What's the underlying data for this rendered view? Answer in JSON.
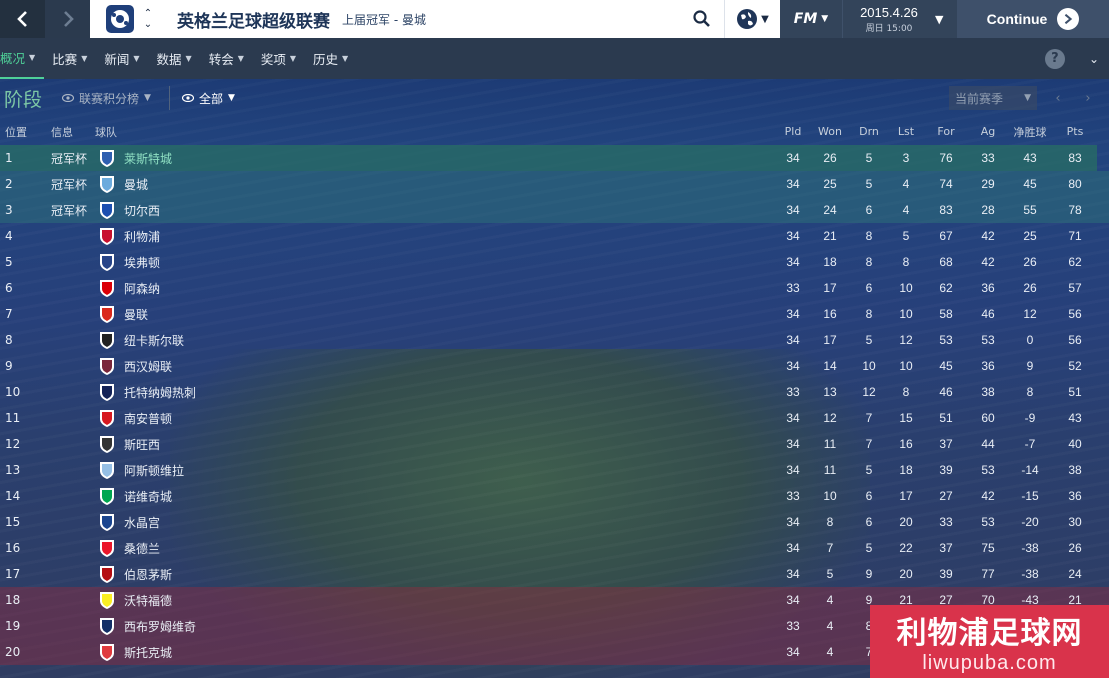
{
  "topbar": {
    "back_icon": "chevron-left-icon",
    "forward_icon": "chevron-right-icon",
    "league_title": "英格兰足球超级联赛",
    "league_subtitle": "上届冠军 - 曼城",
    "fm_label": "FM",
    "date": "2015.4.26",
    "date_sub": "周日 15:00",
    "continue_label": "Continue"
  },
  "menu": {
    "items": [
      {
        "label": "概况",
        "active": true
      },
      {
        "label": "比赛"
      },
      {
        "label": "新闻"
      },
      {
        "label": "数据"
      },
      {
        "label": "转会"
      },
      {
        "label": "奖项"
      },
      {
        "label": "历史"
      }
    ],
    "help_label": "?"
  },
  "filters": {
    "stage_label": "阶段",
    "table_select": "联赛积分榜",
    "view_select": "全部",
    "season_select": "当前赛季"
  },
  "table": {
    "headers": {
      "pos": "位置",
      "info": "信息",
      "team": "球队",
      "pld": "Pld",
      "won": "Won",
      "drn": "Drn",
      "lst": "Lst",
      "for": "For",
      "ag": "Ag",
      "gd": "净胜球",
      "pts": "Pts"
    },
    "rows": [
      {
        "pos": "1",
        "info": "冠军杯",
        "team": "莱斯特城",
        "pld": "34",
        "won": "26",
        "drn": "5",
        "lst": "3",
        "for": "76",
        "ag": "33",
        "gd": "43",
        "pts": "83",
        "badge_color": "#2f5fb0"
      },
      {
        "pos": "2",
        "info": "冠军杯",
        "team": "曼城",
        "pld": "34",
        "won": "25",
        "drn": "5",
        "lst": "4",
        "for": "74",
        "ag": "29",
        "gd": "45",
        "pts": "80",
        "badge_color": "#6cabdd"
      },
      {
        "pos": "3",
        "info": "冠军杯",
        "team": "切尔西",
        "pld": "34",
        "won": "24",
        "drn": "6",
        "lst": "4",
        "for": "83",
        "ag": "28",
        "gd": "55",
        "pts": "78",
        "badge_color": "#1d4fb0"
      },
      {
        "pos": "4",
        "info": "",
        "team": "利物浦",
        "pld": "34",
        "won": "21",
        "drn": "8",
        "lst": "5",
        "for": "67",
        "ag": "42",
        "gd": "25",
        "pts": "71",
        "badge_color": "#c8102e"
      },
      {
        "pos": "5",
        "info": "",
        "team": "埃弗顿",
        "pld": "34",
        "won": "18",
        "drn": "8",
        "lst": "8",
        "for": "68",
        "ag": "42",
        "gd": "26",
        "pts": "62",
        "badge_color": "#274488"
      },
      {
        "pos": "6",
        "info": "",
        "team": "阿森纳",
        "pld": "33",
        "won": "17",
        "drn": "6",
        "lst": "10",
        "for": "62",
        "ag": "36",
        "gd": "26",
        "pts": "57",
        "badge_color": "#db0007"
      },
      {
        "pos": "7",
        "info": "",
        "team": "曼联",
        "pld": "34",
        "won": "16",
        "drn": "8",
        "lst": "10",
        "for": "58",
        "ag": "46",
        "gd": "12",
        "pts": "56",
        "badge_color": "#da291c"
      },
      {
        "pos": "8",
        "info": "",
        "team": "纽卡斯尔联",
        "pld": "34",
        "won": "17",
        "drn": "5",
        "lst": "12",
        "for": "53",
        "ag": "53",
        "gd": "0",
        "pts": "56",
        "badge_color": "#222222"
      },
      {
        "pos": "9",
        "info": "",
        "team": "西汉姆联",
        "pld": "34",
        "won": "14",
        "drn": "10",
        "lst": "10",
        "for": "45",
        "ag": "36",
        "gd": "9",
        "pts": "52",
        "badge_color": "#7a263a"
      },
      {
        "pos": "10",
        "info": "",
        "team": "托特纳姆热刺",
        "pld": "33",
        "won": "13",
        "drn": "12",
        "lst": "8",
        "for": "46",
        "ag": "38",
        "gd": "8",
        "pts": "51",
        "badge_color": "#132257"
      },
      {
        "pos": "11",
        "info": "",
        "team": "南安普顿",
        "pld": "34",
        "won": "12",
        "drn": "7",
        "lst": "15",
        "for": "51",
        "ag": "60",
        "gd": "-9",
        "pts": "43",
        "badge_color": "#d71920"
      },
      {
        "pos": "12",
        "info": "",
        "team": "斯旺西",
        "pld": "34",
        "won": "11",
        "drn": "7",
        "lst": "16",
        "for": "37",
        "ag": "44",
        "gd": "-7",
        "pts": "40",
        "badge_color": "#333333"
      },
      {
        "pos": "13",
        "info": "",
        "team": "阿斯顿维拉",
        "pld": "34",
        "won": "11",
        "drn": "5",
        "lst": "18",
        "for": "39",
        "ag": "53",
        "gd": "-14",
        "pts": "38",
        "badge_color": "#95bfe5"
      },
      {
        "pos": "14",
        "info": "",
        "team": "诺维奇城",
        "pld": "33",
        "won": "10",
        "drn": "6",
        "lst": "17",
        "for": "27",
        "ag": "42",
        "gd": "-15",
        "pts": "36",
        "badge_color": "#00a650"
      },
      {
        "pos": "15",
        "info": "",
        "team": "水晶宫",
        "pld": "34",
        "won": "8",
        "drn": "6",
        "lst": "20",
        "for": "33",
        "ag": "53",
        "gd": "-20",
        "pts": "30",
        "badge_color": "#1b458f"
      },
      {
        "pos": "16",
        "info": "",
        "team": "桑德兰",
        "pld": "34",
        "won": "7",
        "drn": "5",
        "lst": "22",
        "for": "37",
        "ag": "75",
        "gd": "-38",
        "pts": "26",
        "badge_color": "#eb172b"
      },
      {
        "pos": "17",
        "info": "",
        "team": "伯恩茅斯",
        "pld": "34",
        "won": "5",
        "drn": "9",
        "lst": "20",
        "for": "39",
        "ag": "77",
        "gd": "-38",
        "pts": "24",
        "badge_color": "#b50e12"
      },
      {
        "pos": "18",
        "info": "",
        "team": "沃特福德",
        "pld": "34",
        "won": "4",
        "drn": "9",
        "lst": "21",
        "for": "27",
        "ag": "70",
        "gd": "-43",
        "pts": "21",
        "badge_color": "#fbee23"
      },
      {
        "pos": "19",
        "info": "",
        "team": "西布罗姆维奇",
        "pld": "33",
        "won": "4",
        "drn": "8",
        "lst": "",
        "for": "",
        "ag": "",
        "gd": "",
        "pts": "",
        "badge_color": "#122f67"
      },
      {
        "pos": "20",
        "info": "",
        "team": "斯托克城",
        "pld": "34",
        "won": "4",
        "drn": "7",
        "lst": "",
        "for": "",
        "ag": "",
        "gd": "",
        "pts": "",
        "badge_color": "#e03a3e"
      }
    ]
  },
  "watermark": {
    "text_cn": "利物浦足球网",
    "text_en": "liwupuba.com"
  }
}
